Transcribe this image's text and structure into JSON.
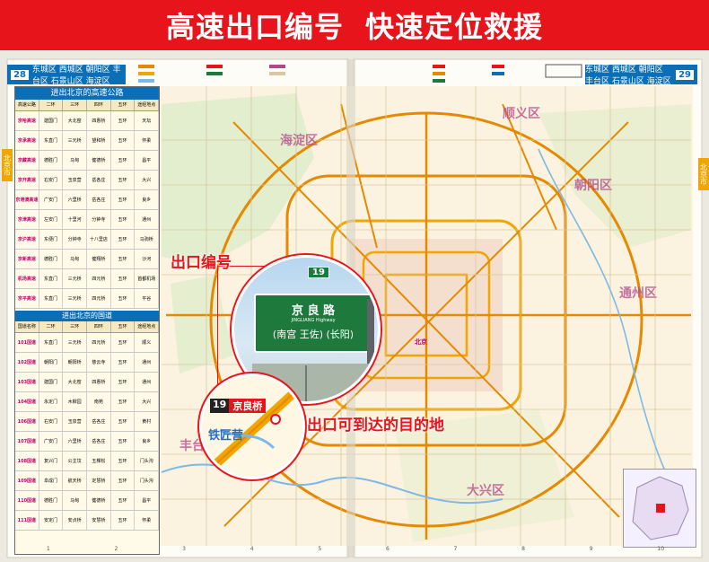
{
  "banner": {
    "left_text": "高速出口编号",
    "right_text": "快速定位救援"
  },
  "header": {
    "left_page": "28",
    "left_districts": "东城区 西城区 朝阳区 丰台区 石景山区 海淀区",
    "right_page": "29",
    "right_districts": "东城区 西城区 朝阳区 丰台区 石景山区 海淀区"
  },
  "side_tabs": {
    "left": "北京市",
    "right": "北京市"
  },
  "tables": {
    "highway_title": "进出北京的高速公路",
    "highway_cols": [
      "高速公路",
      "二环",
      "三环",
      "四环",
      "五环",
      "途经地点"
    ],
    "highway_rows": [
      [
        "京哈高速",
        "建国门",
        "大北窑",
        "四惠桥",
        "五环",
        "天坛"
      ],
      [
        "京承高速",
        "东直门",
        "三元桥",
        "望和桥",
        "五环",
        "怀柔"
      ],
      [
        "京藏高速",
        "德胜门",
        "马甸",
        "健德桥",
        "五环",
        "昌平"
      ],
      [
        "京开高速",
        "右安门",
        "玉泉营",
        "岳各庄",
        "五环",
        "大兴"
      ],
      [
        "京港澳高速",
        "广安门",
        "六里桥",
        "岳各庄",
        "五环",
        "良乡"
      ],
      [
        "京津高速",
        "左安门",
        "十里河",
        "分钟寺",
        "五环",
        "通州"
      ],
      [
        "京沪高速",
        "东便门",
        "分钟寺",
        "十八里店",
        "五环",
        "马驹桥"
      ],
      [
        "京新高速",
        "德胜门",
        "马甸",
        "健翔桥",
        "五环",
        "沙河"
      ],
      [
        "机场高速",
        "东直门",
        "三元桥",
        "四元桥",
        "五环",
        "首都机场"
      ],
      [
        "京平高速",
        "东直门",
        "三元桥",
        "四元桥",
        "五环",
        "平谷"
      ]
    ],
    "national_title": "进出北京的国道",
    "national_cols": [
      "国道名称",
      "二环",
      "三环",
      "四环",
      "五环",
      "途经地点"
    ],
    "national_rows": [
      [
        "101国道",
        "东直门",
        "三元桥",
        "四元桥",
        "五环",
        "顺义"
      ],
      [
        "102国道",
        "朝阳门",
        "朝阳桥",
        "慈云寺",
        "五环",
        "通州"
      ],
      [
        "103国道",
        "建国门",
        "大北窑",
        "四惠桥",
        "五环",
        "通州"
      ],
      [
        "104国道",
        "永定门",
        "木樨园",
        "南苑",
        "五环",
        "大兴"
      ],
      [
        "106国道",
        "右安门",
        "玉泉营",
        "岳各庄",
        "五环",
        "黄村"
      ],
      [
        "107国道",
        "广安门",
        "六里桥",
        "岳各庄",
        "五环",
        "良乡"
      ],
      [
        "108国道",
        "复兴门",
        "公主坟",
        "五棵松",
        "五环",
        "门头沟"
      ],
      [
        "109国道",
        "阜成门",
        "航天桥",
        "定慧桥",
        "五环",
        "门头沟"
      ],
      [
        "110国道",
        "德胜门",
        "马甸",
        "健德桥",
        "五环",
        "昌平"
      ],
      [
        "111国道",
        "安定门",
        "安贞桥",
        "安慧桥",
        "五环",
        "怀柔"
      ]
    ]
  },
  "callouts": {
    "exit_number_label": "出口编号",
    "destination_label": "出口可到达的目的地",
    "sign_number": "19",
    "sign_main": "京 良 路",
    "sign_pinyin": "JINGLIANG Highway",
    "sign_sub": "(南宫 王佐) (长阳)",
    "map_exit_number": "19",
    "map_exit_name": "京良桥",
    "map_station": "铁匠营"
  },
  "map_labels": {
    "beijing": "北京",
    "districts": [
      "海淀区",
      "朝阳区",
      "丰台区",
      "通州区",
      "大兴区",
      "顺义区"
    ]
  },
  "scale_ticks": [
    "1",
    "2",
    "3",
    "4",
    "5",
    "6",
    "7",
    "8",
    "9",
    "10"
  ],
  "colors": {
    "banner_red": "#e8141c",
    "header_blue": "#0a6fb6",
    "highway_orange": "#f0a500",
    "district_pink": "#b5468b",
    "sign_green": "#1d7a3c"
  }
}
